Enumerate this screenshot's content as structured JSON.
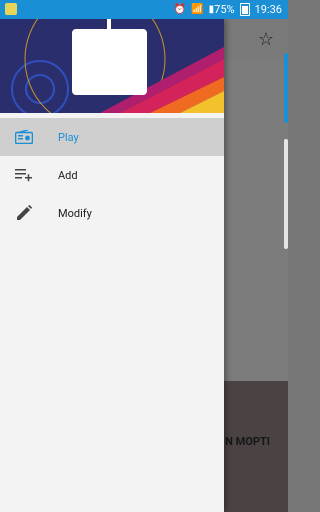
{
  "statusbar": {
    "battery": "75%",
    "time": "19:36"
  },
  "drawer": {
    "menu": [
      {
        "label": "Play",
        "icon": "radio-icon",
        "active": true
      },
      {
        "label": "Add",
        "icon": "playlist-add-icon",
        "active": false
      },
      {
        "label": "Modify",
        "icon": "pencil-icon",
        "active": false
      }
    ]
  },
  "background": {
    "bottom_text": "N MOPTI"
  },
  "colors": {
    "accent": "#1a8fd6",
    "drawer_bg": "#f3f3f3",
    "active_row": "#cfcfcf"
  }
}
